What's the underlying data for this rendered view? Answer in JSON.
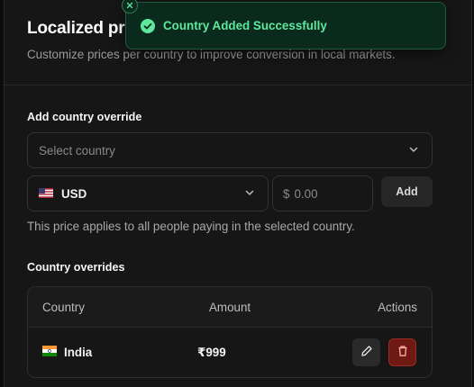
{
  "header": {
    "title": "Localized pri",
    "subtitle": "Customize prices per country to improve conversion in local markets."
  },
  "override_form": {
    "section_label": "Add country override",
    "country_select_placeholder": "Select country",
    "currency_code": "USD",
    "currency_flag": "us-flag-icon",
    "price_symbol": "$",
    "price_placeholder": "0.00",
    "add_label": "Add",
    "help_text": "This price applies to all people paying in the selected country."
  },
  "overrides": {
    "section_label": "Country overrides",
    "columns": [
      "Country",
      "Amount",
      "Actions"
    ],
    "rows": [
      {
        "country": "India",
        "flag": "india-flag-icon",
        "amount": "₹999"
      }
    ]
  },
  "toast": {
    "message": "Country Added Successfully",
    "type": "success"
  },
  "colors": {
    "background": "#161616",
    "toast_background": "#0b2a1e",
    "toast_text": "#5ee89c",
    "delete_button": "#6e1a13"
  }
}
